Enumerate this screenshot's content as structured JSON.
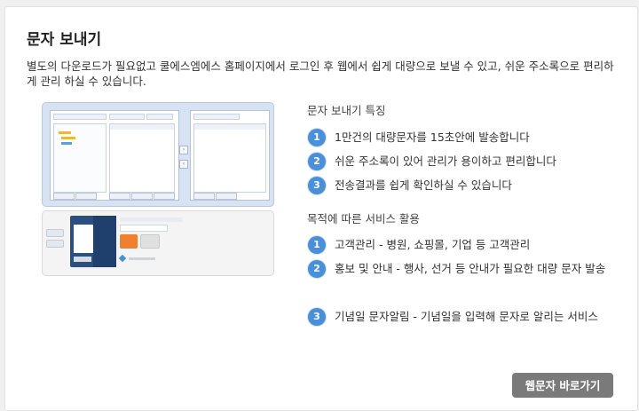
{
  "page": {
    "title": "문자 보내기",
    "description": "별도의 다운로드가 필요없고 쿨에스엠에스 홈페이지에서 로그인 후 웹에서 쉽게 대량으로 보낼 수 있고, 쉬운 주소록으로 편리하게 관리 하실 수 있습니다."
  },
  "features": {
    "title": "문자 보내기 특징",
    "items": [
      {
        "num": "1",
        "text": "1만건의 대량문자를 15초안에 발송합니다"
      },
      {
        "num": "2",
        "text": "쉬운 주소록이 있어 관리가 용이하고 편리합니다"
      },
      {
        "num": "3",
        "text": "전송결과를 쉽게 확인하실 수 있습니다"
      }
    ]
  },
  "services": {
    "title": "목적에 따른 서비스 활용",
    "items": [
      {
        "num": "1",
        "text": "고객관리 - 병원, 쇼핑몰, 기업 등 고객관리"
      },
      {
        "num": "2",
        "text": "홍보 및 안내 - 행사, 선거 등 안내가 필요한 대량 문자 발송"
      },
      {
        "num": "3",
        "text": "기념일 문자알림 - 기념일을 입력해 문자로 알리는 서비스"
      }
    ]
  },
  "actions": {
    "web_button": "웹문자 바로가기"
  },
  "colors": {
    "accent": "#4a8fd8",
    "button": "#7a7a7a"
  }
}
